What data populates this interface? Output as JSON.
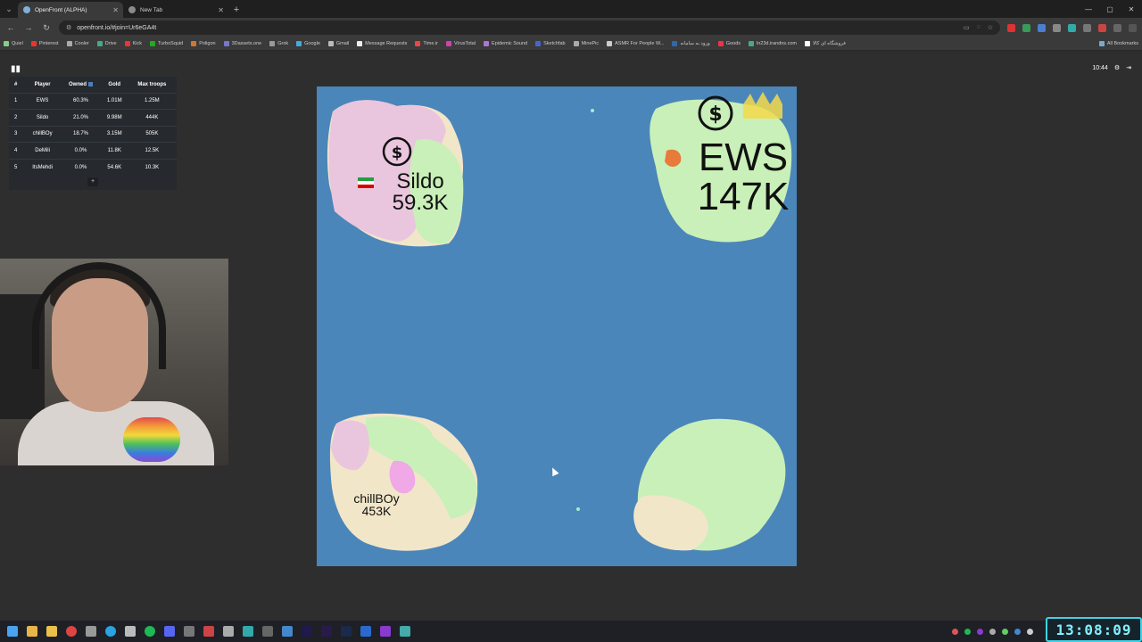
{
  "browser": {
    "tabs": [
      {
        "title": "OpenFront (ALPHA)",
        "active": true
      },
      {
        "title": "New Tab",
        "active": false
      }
    ],
    "new_tab_symbol": "+",
    "address": "openfront.io/#join=Ur6eGA4t",
    "bookmarks": [
      "Quiel",
      "Pinterest",
      "Cooler",
      "Drive",
      "Kick",
      "TurboSquid",
      "Poligon",
      "3Dassets.one",
      "Grok",
      "Google",
      "Gmail",
      "Message Requests",
      "Time.ir",
      "VirusTotal",
      "Epidemic Sound",
      "Sketchfab",
      "MinePic",
      "ASMR For People W...",
      "ورود به سامانه",
      "Goods",
      "ln23d.irandns.com",
      "فروشگاه ای کالا",
      "All Bookmarks"
    ]
  },
  "game": {
    "leaderboard": {
      "headers": [
        "#",
        "Player",
        "Owned",
        "Gold",
        "Max troops"
      ],
      "rows": [
        {
          "rank": "1",
          "player": "EWS",
          "owned": "60.3%",
          "gold": "1.01M",
          "troops": "1.25M"
        },
        {
          "rank": "2",
          "player": "Sildo",
          "owned": "21.0%",
          "gold": "9.98M",
          "troops": "444K"
        },
        {
          "rank": "3",
          "player": "chillBOy",
          "owned": "18.7%",
          "gold": "3.15M",
          "troops": "505K"
        },
        {
          "rank": "4",
          "player": "DeMili",
          "owned": "0.0%",
          "gold": "11.8K",
          "troops": "12.5K"
        },
        {
          "rank": "5",
          "player": "ItsMehdi",
          "owned": "0.0%",
          "gold": "54.6K",
          "troops": "10.3K"
        }
      ],
      "more_label": "+"
    },
    "timer": "10:44",
    "players_on_map": [
      {
        "name": "EWS",
        "troops": "147K"
      },
      {
        "name": "Sildo",
        "troops": "59.3K"
      },
      {
        "name": "chillBOy",
        "troops": "453K"
      }
    ]
  },
  "taskbar": {
    "clock": "13:08:09"
  }
}
